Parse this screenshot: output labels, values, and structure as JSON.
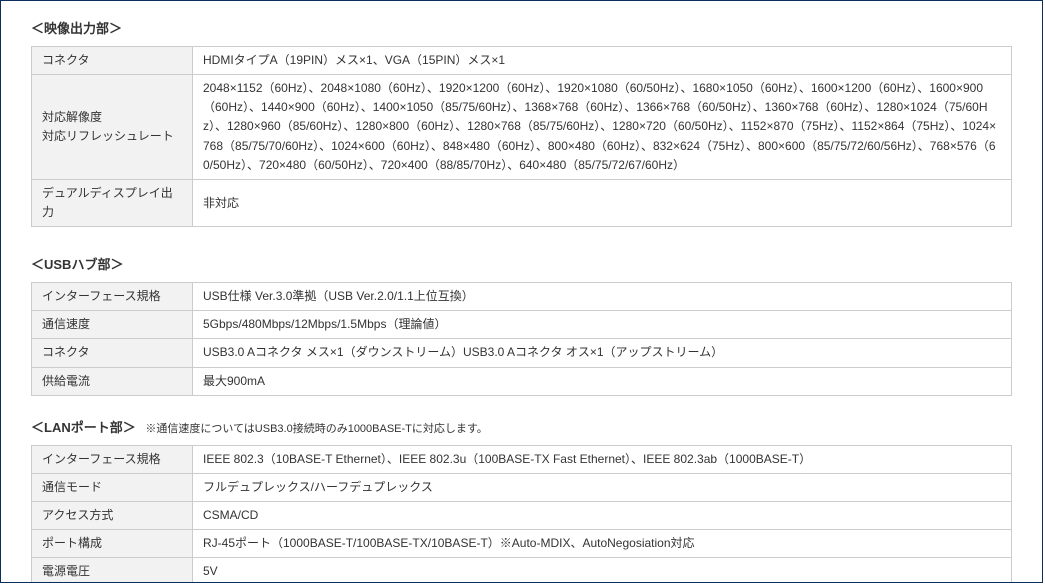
{
  "video_out": {
    "heading": "＜映像出力部＞",
    "rows": {
      "connector_label": "コネクタ",
      "connector_value": "HDMIタイプA（19PIN）メス×1、VGA（15PIN）メス×1",
      "resolution_label": "対応解像度\n対応リフレッシュレート",
      "resolution_value": "2048×1152（60Hz）、2048×1080（60Hz）、1920×1200（60Hz）、1920×1080（60/50Hz）、1680×1050（60Hz）、1600×1200（60Hz）、1600×900（60Hz）、1440×900（60Hz）、1400×1050（85/75/60Hz）、1368×768（60Hz）、1366×768（60/50Hz）、1360×768（60Hz）、1280×1024（75/60Hz）、1280×960（85/60Hz）、1280×800（60Hz）、1280×768（85/75/60Hz）、1280×720（60/50Hz）、1152×870（75Hz）、1152×864（75Hz）、1024×768（85/75/70/60Hz）、1024×600（60Hz）、848×480（60Hz）、800×480（60Hz）、832×624（75Hz）、800×600（85/75/72/60/56Hz）、768×576（60/50Hz）、720×480（60/50Hz）、720×400（88/85/70Hz）、640×480（85/75/72/67/60Hz）",
      "dualdisp_label": "デュアルディスプレイ出力",
      "dualdisp_value": "非対応"
    }
  },
  "usb_hub": {
    "heading": "＜USBハブ部＞",
    "rows": {
      "if_label": "インターフェース規格",
      "if_value": "USB仕様 Ver.3.0準拠（USB Ver.2.0/1.1上位互換）",
      "speed_label": "通信速度",
      "speed_value": "5Gbps/480Mbps/12Mbps/1.5Mbps（理論値）",
      "connector_label": "コネクタ",
      "connector_value": "USB3.0 Aコネクタ メス×1（ダウンストリーム）USB3.0 Aコネクタ オス×1（アップストリーム）",
      "current_label": "供給電流",
      "current_value": "最大900mA"
    }
  },
  "lan_port": {
    "heading": "＜LANポート部＞",
    "note": "※通信速度についてはUSB3.0接続時のみ1000BASE-Tに対応します。",
    "rows": {
      "if_label": "インターフェース規格",
      "if_value": "IEEE 802.3（10BASE-T Ethernet）、IEEE 802.3u（100BASE-TX Fast Ethernet）、IEEE 802.3ab（1000BASE-T）",
      "mode_label": "通信モード",
      "mode_value": "フルデュプレックス/ハーフデュプレックス",
      "access_label": "アクセス方式",
      "access_value": "CSMA/CD",
      "port_label": "ポート構成",
      "port_value": "RJ-45ポート（1000BASE-T/100BASE-TX/10BASE-T）※Auto-MDIX、AutoNegosiation対応",
      "volt_label": "電源電圧",
      "volt_value": "5V"
    }
  }
}
